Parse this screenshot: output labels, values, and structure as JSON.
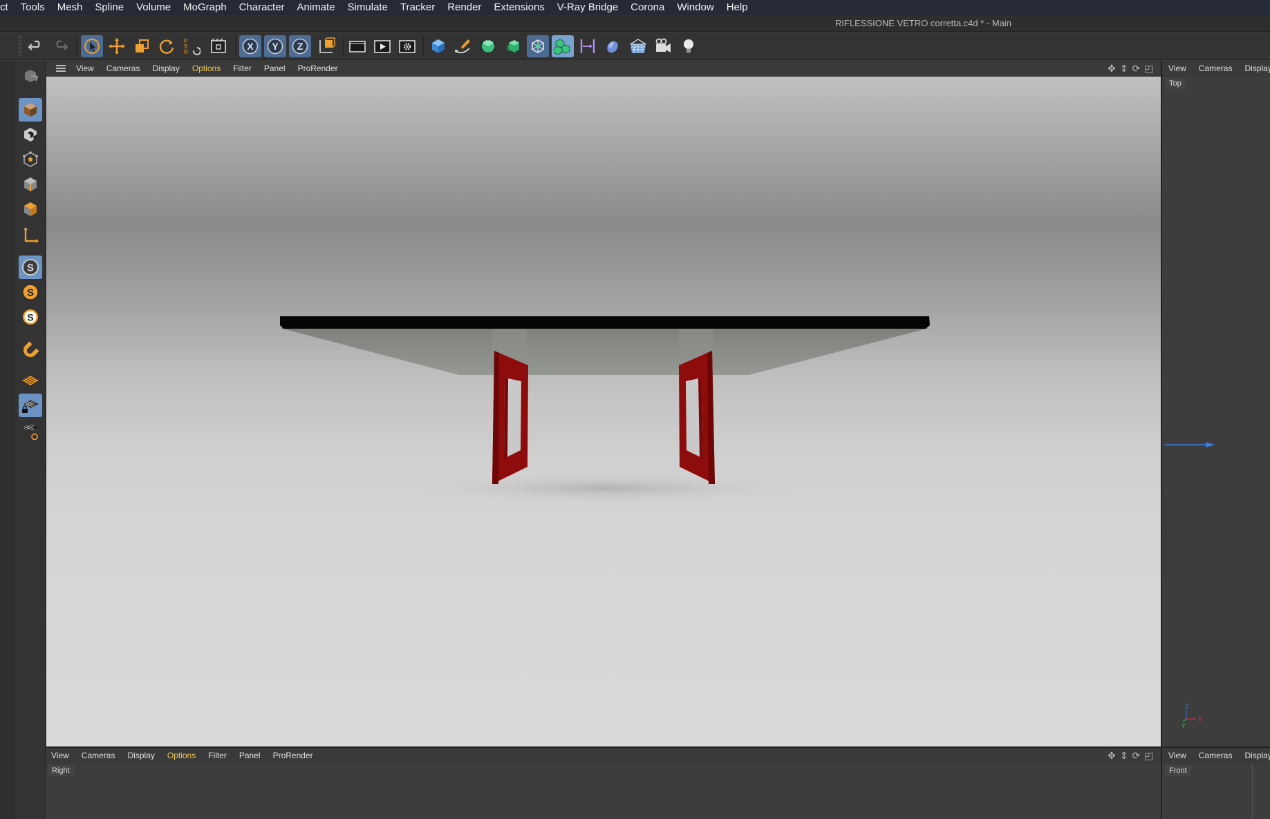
{
  "menubar": {
    "items": [
      "ct",
      "Tools",
      "Mesh",
      "Spline",
      "Volume",
      "MoGraph",
      "Character",
      "Animate",
      "Simulate",
      "Tracker",
      "Render",
      "Extensions",
      "V-Ray Bridge",
      "Corona",
      "Window",
      "Help"
    ]
  },
  "window": {
    "title": "RIFLESSIONE VETRO corretta.c4d * - Main"
  },
  "toolbar": {
    "tools": [
      "undo-icon",
      "redo-icon",
      "live-selection-icon",
      "move-icon",
      "scale-icon",
      "rotate-icon",
      "psr-coordinates-icon",
      "recent-tools-icon",
      "x-axis-lock-icon",
      "y-axis-lock-icon",
      "z-axis-lock-icon",
      "coordinate-system-icon",
      "render-view-icon",
      "render-to-picture-viewer-icon",
      "render-settings-icon",
      "cube-primitive-icon",
      "pen-spline-icon",
      "subdivision-surface-icon",
      "extrude-generator-icon",
      "array-icon",
      "cloner-icon",
      "deformer-icon",
      "field-icon",
      "floor-environment-icon",
      "camera-icon",
      "light-icon"
    ],
    "x_label": "X",
    "y_label": "Y",
    "z_label": "Z"
  },
  "lefttoolbar": {
    "tools": [
      "make-editable-icon",
      "model-mode-icon",
      "texture-mode-icon",
      "points-mode-icon",
      "edges-mode-icon",
      "polygons-mode-icon",
      "axis-mode-icon",
      "solo-off-icon",
      "solo-single-icon",
      "solo-hierarchy-icon",
      "snap-icon",
      "workplane-icon",
      "locked-workplane-icon",
      "planar-workplane-icon"
    ],
    "solo_label": "S"
  },
  "viewport_main": {
    "menu": [
      "View",
      "Cameras",
      "Display",
      "Options",
      "Filter",
      "Panel",
      "ProRender"
    ],
    "highlighted": "Options"
  },
  "viewport_bottom": {
    "menu": [
      "View",
      "Cameras",
      "Display",
      "Options",
      "Filter",
      "Panel",
      "ProRender"
    ],
    "highlighted": "Options",
    "label": "Right"
  },
  "viewport_top_right": {
    "menu": [
      "View",
      "Cameras",
      "Display"
    ],
    "label": "Top"
  },
  "viewport_bottom_right": {
    "menu": [
      "View",
      "Cameras",
      "Display"
    ],
    "label": "Front"
  },
  "axis_gizmo": {
    "z": "Z",
    "x": "X",
    "y": "Y"
  },
  "colors": {
    "table_legs": "#8e0c0c",
    "glass": "#8a8c88",
    "highlight_menu": "#f0c75a",
    "active_tool": "#4d6c93"
  }
}
